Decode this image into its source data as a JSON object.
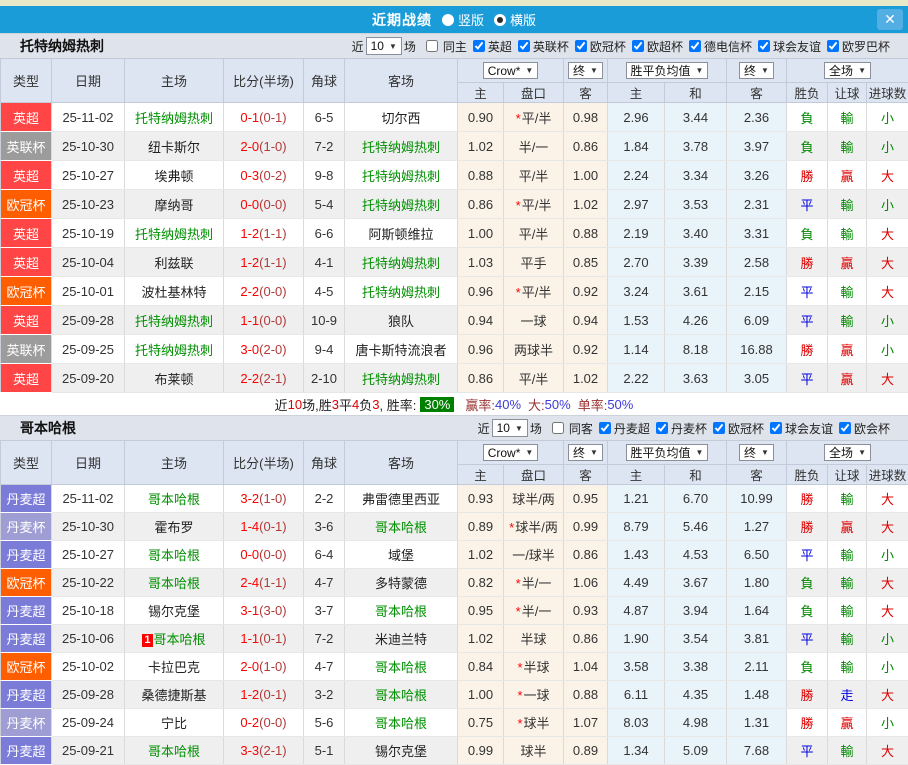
{
  "window": {
    "title": "近期战绩",
    "vertical": "竖版",
    "horizontal": "横版",
    "close": "✕"
  },
  "common": {
    "near": "近",
    "games_value": "10",
    "games_unit": "场",
    "col_headers": [
      "类型",
      "日期",
      "主场",
      "比分(半场)",
      "角球",
      "客场"
    ],
    "odds_headers": [
      "主",
      "盘口",
      "客"
    ],
    "avg_headers": [
      "主",
      "和",
      "客"
    ],
    "result_headers": [
      "胜负",
      "让球",
      "进球数"
    ],
    "dropdowns": {
      "crow": "Crow*",
      "final": "终",
      "avg": "胜平负均值",
      "scope": "全场"
    }
  },
  "league_colors": {
    "英超": "#ff4545",
    "英联杯": "#9c9c9c",
    "欧冠杯": "#ff5e00",
    "丹麦超": "#7b7bd8",
    "丹麦杯": "#9e9ed4"
  },
  "result_colors": {
    "勝": "#dd0000",
    "負": "#008800",
    "平": "#0000dd",
    "贏": "#dd0000",
    "輸": "#008800",
    "走": "#0000dd",
    "大": "#dd0000",
    "小": "#008800"
  },
  "sections": [
    {
      "team": "托特纳姆热刺",
      "same_label": "同主",
      "leagues": [
        "英超",
        "英联杯",
        "欧冠杯",
        "欧超杯",
        "德电信杯",
        "球会友谊",
        "欧罗巴杯"
      ],
      "rows": [
        {
          "league": "英超",
          "date": "25-11-02",
          "home": "托特纳姆热刺",
          "home_focus": true,
          "home_tag": "",
          "score": "0-1",
          "half": "(0-1)",
          "corners": "6-5",
          "away": "切尔西",
          "away_focus": false,
          "odds_home": "0.90",
          "star": "*",
          "line": "平/半",
          "odds_away": "0.98",
          "avg_home": "2.96",
          "avg_draw": "3.44",
          "avg_away": "2.36",
          "res_wdl": "負",
          "res_handicap": "輸",
          "res_goals": "小"
        },
        {
          "league": "英联杯",
          "date": "25-10-30",
          "home": "纽卡斯尔",
          "home_focus": false,
          "home_tag": "",
          "score": "2-0",
          "half": "(1-0)",
          "corners": "7-2",
          "away": "托特纳姆热刺",
          "away_focus": true,
          "odds_home": "1.02",
          "star": "",
          "line": "半/一",
          "odds_away": "0.86",
          "avg_home": "1.84",
          "avg_draw": "3.78",
          "avg_away": "3.97",
          "res_wdl": "負",
          "res_handicap": "輸",
          "res_goals": "小"
        },
        {
          "league": "英超",
          "date": "25-10-27",
          "home": "埃弗顿",
          "home_focus": false,
          "home_tag": "",
          "score": "0-3",
          "half": "(0-2)",
          "corners": "9-8",
          "away": "托特纳姆热刺",
          "away_focus": true,
          "odds_home": "0.88",
          "star": "",
          "line": "平/半",
          "odds_away": "1.00",
          "avg_home": "2.24",
          "avg_draw": "3.34",
          "avg_away": "3.26",
          "res_wdl": "勝",
          "res_handicap": "贏",
          "res_goals": "大"
        },
        {
          "league": "欧冠杯",
          "date": "25-10-23",
          "home": "摩纳哥",
          "home_focus": false,
          "home_tag": "",
          "score": "0-0",
          "half": "(0-0)",
          "corners": "5-4",
          "away": "托特纳姆热刺",
          "away_focus": true,
          "odds_home": "0.86",
          "star": "*",
          "line": "平/半",
          "odds_away": "1.02",
          "avg_home": "2.97",
          "avg_draw": "3.53",
          "avg_away": "2.31",
          "res_wdl": "平",
          "res_handicap": "輸",
          "res_goals": "小"
        },
        {
          "league": "英超",
          "date": "25-10-19",
          "home": "托特纳姆热刺",
          "home_focus": true,
          "home_tag": "",
          "score": "1-2",
          "half": "(1-1)",
          "corners": "6-6",
          "away": "阿斯顿维拉",
          "away_focus": false,
          "odds_home": "1.00",
          "star": "",
          "line": "平/半",
          "odds_away": "0.88",
          "avg_home": "2.19",
          "avg_draw": "3.40",
          "avg_away": "3.31",
          "res_wdl": "負",
          "res_handicap": "輸",
          "res_goals": "大"
        },
        {
          "league": "英超",
          "date": "25-10-04",
          "home": "利兹联",
          "home_focus": false,
          "home_tag": "",
          "score": "1-2",
          "half": "(1-1)",
          "corners": "4-1",
          "away": "托特纳姆热刺",
          "away_focus": true,
          "odds_home": "1.03",
          "star": "",
          "line": "平手",
          "odds_away": "0.85",
          "avg_home": "2.70",
          "avg_draw": "3.39",
          "avg_away": "2.58",
          "res_wdl": "勝",
          "res_handicap": "贏",
          "res_goals": "大"
        },
        {
          "league": "欧冠杯",
          "date": "25-10-01",
          "home": "波杜基林特",
          "home_focus": false,
          "home_tag": "",
          "score": "2-2",
          "half": "(0-0)",
          "corners": "4-5",
          "away": "托特纳姆热刺",
          "away_focus": true,
          "odds_home": "0.96",
          "star": "*",
          "line": "平/半",
          "odds_away": "0.92",
          "avg_home": "3.24",
          "avg_draw": "3.61",
          "avg_away": "2.15",
          "res_wdl": "平",
          "res_handicap": "輸",
          "res_goals": "大"
        },
        {
          "league": "英超",
          "date": "25-09-28",
          "home": "托特纳姆热刺",
          "home_focus": true,
          "home_tag": "",
          "score": "1-1",
          "half": "(0-0)",
          "corners": "10-9",
          "away": "狼队",
          "away_focus": false,
          "odds_home": "0.94",
          "star": "",
          "line": "一球",
          "odds_away": "0.94",
          "avg_home": "1.53",
          "avg_draw": "4.26",
          "avg_away": "6.09",
          "res_wdl": "平",
          "res_handicap": "輸",
          "res_goals": "小"
        },
        {
          "league": "英联杯",
          "date": "25-09-25",
          "home": "托特纳姆热刺",
          "home_focus": true,
          "home_tag": "",
          "score": "3-0",
          "half": "(2-0)",
          "corners": "9-4",
          "away": "唐卡斯特流浪者",
          "away_focus": false,
          "odds_home": "0.96",
          "star": "",
          "line": "两球半",
          "odds_away": "0.92",
          "avg_home": "1.14",
          "avg_draw": "8.18",
          "avg_away": "16.88",
          "res_wdl": "勝",
          "res_handicap": "贏",
          "res_goals": "小"
        },
        {
          "league": "英超",
          "date": "25-09-20",
          "home": "布莱顿",
          "home_focus": false,
          "home_tag": "",
          "score": "2-2",
          "half": "(2-1)",
          "corners": "2-10",
          "away": "托特纳姆热刺",
          "away_focus": true,
          "odds_home": "0.86",
          "star": "",
          "line": "平/半",
          "odds_away": "1.02",
          "avg_home": "2.22",
          "avg_draw": "3.63",
          "avg_away": "3.05",
          "res_wdl": "平",
          "res_handicap": "贏",
          "res_goals": "大"
        }
      ],
      "summary": [
        {
          "t": "近",
          "c": "black"
        },
        {
          "t": "10",
          "c": "red"
        },
        {
          "t": "场,胜",
          "c": "black"
        },
        {
          "t": "3",
          "c": "red"
        },
        {
          "t": "平",
          "c": "black"
        },
        {
          "t": "4",
          "c": "red"
        },
        {
          "t": "负",
          "c": "black"
        },
        {
          "t": "3",
          "c": "red"
        },
        {
          "t": ", 胜率:",
          "c": "black"
        },
        {
          "t": "30%",
          "c": "badge"
        },
        {
          "t": "赢率:",
          "c": "maroon"
        },
        {
          "t": "40%",
          "c": "blue"
        },
        {
          "t": "大:",
          "c": "maroon"
        },
        {
          "t": "50%",
          "c": "blue"
        },
        {
          "t": "单率:",
          "c": "maroon"
        },
        {
          "t": "50%",
          "c": "blue"
        }
      ]
    },
    {
      "team": "哥本哈根",
      "same_label": "同客",
      "leagues": [
        "丹麦超",
        "丹麦杯",
        "欧冠杯",
        "球会友谊",
        "欧会杯"
      ],
      "rows": [
        {
          "league": "丹麦超",
          "date": "25-11-02",
          "home": "哥本哈根",
          "home_focus": true,
          "home_tag": "",
          "score": "3-2",
          "half": "(1-0)",
          "corners": "2-2",
          "away": "弗雷德里西亚",
          "away_focus": false,
          "odds_home": "0.93",
          "star": "",
          "line": "球半/两",
          "odds_away": "0.95",
          "avg_home": "1.21",
          "avg_draw": "6.70",
          "avg_away": "10.99",
          "res_wdl": "勝",
          "res_handicap": "輸",
          "res_goals": "大"
        },
        {
          "league": "丹麦杯",
          "date": "25-10-30",
          "home": "霍布罗",
          "home_focus": false,
          "home_tag": "",
          "score": "1-4",
          "half": "(0-1)",
          "corners": "3-6",
          "away": "哥本哈根",
          "away_focus": true,
          "odds_home": "0.89",
          "star": "*",
          "line": "球半/两",
          "odds_away": "0.99",
          "avg_home": "8.79",
          "avg_draw": "5.46",
          "avg_away": "1.27",
          "res_wdl": "勝",
          "res_handicap": "贏",
          "res_goals": "大"
        },
        {
          "league": "丹麦超",
          "date": "25-10-27",
          "home": "哥本哈根",
          "home_focus": true,
          "home_tag": "",
          "score": "0-0",
          "half": "(0-0)",
          "corners": "6-4",
          "away": "域堡",
          "away_focus": false,
          "odds_home": "1.02",
          "star": "",
          "line": "一/球半",
          "odds_away": "0.86",
          "avg_home": "1.43",
          "avg_draw": "4.53",
          "avg_away": "6.50",
          "res_wdl": "平",
          "res_handicap": "輸",
          "res_goals": "小"
        },
        {
          "league": "欧冠杯",
          "date": "25-10-22",
          "home": "哥本哈根",
          "home_focus": true,
          "home_tag": "",
          "score": "2-4",
          "half": "(1-1)",
          "corners": "4-7",
          "away": "多特蒙德",
          "away_focus": false,
          "odds_home": "0.82",
          "star": "*",
          "line": "半/一",
          "odds_away": "1.06",
          "avg_home": "4.49",
          "avg_draw": "3.67",
          "avg_away": "1.80",
          "res_wdl": "負",
          "res_handicap": "輸",
          "res_goals": "大"
        },
        {
          "league": "丹麦超",
          "date": "25-10-18",
          "home": "锡尔克堡",
          "home_focus": false,
          "home_tag": "",
          "score": "3-1",
          "half": "(3-0)",
          "corners": "3-7",
          "away": "哥本哈根",
          "away_focus": true,
          "odds_home": "0.95",
          "star": "*",
          "line": "半/一",
          "odds_away": "0.93",
          "avg_home": "4.87",
          "avg_draw": "3.94",
          "avg_away": "1.64",
          "res_wdl": "負",
          "res_handicap": "輸",
          "res_goals": "大"
        },
        {
          "league": "丹麦超",
          "date": "25-10-06",
          "home": "哥本哈根",
          "home_focus": true,
          "home_tag": "1",
          "score": "1-1",
          "half": "(0-1)",
          "corners": "7-2",
          "away": "米迪兰特",
          "away_focus": false,
          "odds_home": "1.02",
          "star": "",
          "line": "半球",
          "odds_away": "0.86",
          "avg_home": "1.90",
          "avg_draw": "3.54",
          "avg_away": "3.81",
          "res_wdl": "平",
          "res_handicap": "輸",
          "res_goals": "小"
        },
        {
          "league": "欧冠杯",
          "date": "25-10-02",
          "home": "卡拉巴克",
          "home_focus": false,
          "home_tag": "",
          "score": "2-0",
          "half": "(1-0)",
          "corners": "4-7",
          "away": "哥本哈根",
          "away_focus": true,
          "odds_home": "0.84",
          "star": "*",
          "line": "半球",
          "odds_away": "1.04",
          "avg_home": "3.58",
          "avg_draw": "3.38",
          "avg_away": "2.11",
          "res_wdl": "負",
          "res_handicap": "輸",
          "res_goals": "小"
        },
        {
          "league": "丹麦超",
          "date": "25-09-28",
          "home": "桑德捷斯基",
          "home_focus": false,
          "home_tag": "",
          "score": "1-2",
          "half": "(0-1)",
          "corners": "3-2",
          "away": "哥本哈根",
          "away_focus": true,
          "odds_home": "1.00",
          "star": "*",
          "line": "一球",
          "odds_away": "0.88",
          "avg_home": "6.11",
          "avg_draw": "4.35",
          "avg_away": "1.48",
          "res_wdl": "勝",
          "res_handicap": "走",
          "res_goals": "大"
        },
        {
          "league": "丹麦杯",
          "date": "25-09-24",
          "home": "宁比",
          "home_focus": false,
          "home_tag": "",
          "score": "0-2",
          "half": "(0-0)",
          "corners": "5-6",
          "away": "哥本哈根",
          "away_focus": true,
          "odds_home": "0.75",
          "star": "*",
          "line": "球半",
          "odds_away": "1.07",
          "avg_home": "8.03",
          "avg_draw": "4.98",
          "avg_away": "1.31",
          "res_wdl": "勝",
          "res_handicap": "贏",
          "res_goals": "小"
        },
        {
          "league": "丹麦超",
          "date": "25-09-21",
          "home": "哥本哈根",
          "home_focus": true,
          "home_tag": "",
          "score": "3-3",
          "half": "(2-1)",
          "corners": "5-1",
          "away": "锡尔克堡",
          "away_focus": false,
          "odds_home": "0.99",
          "star": "",
          "line": "球半",
          "odds_away": "0.89",
          "avg_home": "1.34",
          "avg_draw": "5.09",
          "avg_away": "7.68",
          "res_wdl": "平",
          "res_handicap": "輸",
          "res_goals": "大"
        }
      ]
    }
  ]
}
